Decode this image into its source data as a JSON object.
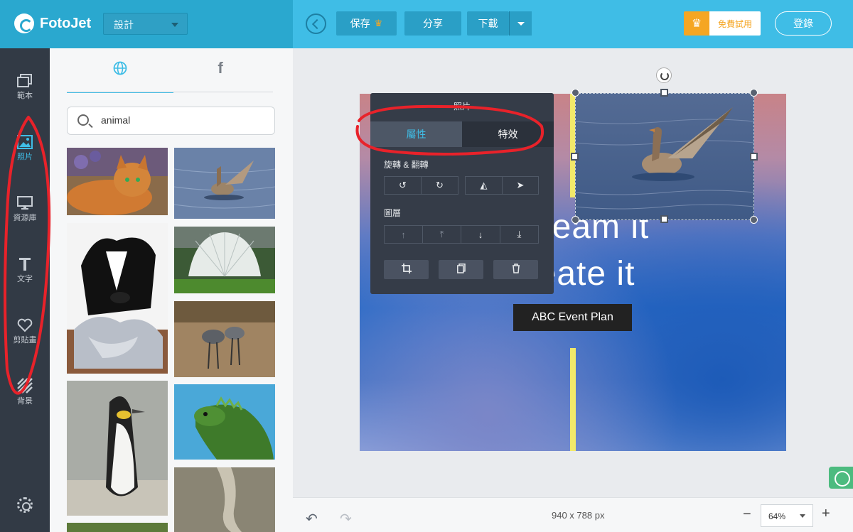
{
  "app": {
    "name": "FotoJet"
  },
  "header": {
    "design_select": "設計",
    "save_label": "保存",
    "share_label": "分享",
    "download_label": "下載",
    "trial_label": "免費試用",
    "login_label": "登錄",
    "colors": {
      "bar": "#3fbde6",
      "bar_left": "#2aa8cf",
      "crown": "#f5a623"
    }
  },
  "sidebar": {
    "items": [
      {
        "label": "範本",
        "icon": "templates-icon"
      },
      {
        "label": "照片",
        "icon": "photo-icon",
        "active": true
      },
      {
        "label": "資源庫",
        "icon": "monitor-icon"
      },
      {
        "label": "文字",
        "icon": "text-icon"
      },
      {
        "label": "剪貼畫",
        "icon": "heart-icon"
      },
      {
        "label": "背景",
        "icon": "background-icon"
      }
    ],
    "settings_icon": "gear-icon"
  },
  "photo_panel": {
    "tabs": [
      {
        "name": "web",
        "icon": "globe-icon",
        "active": true
      },
      {
        "name": "facebook",
        "icon": "facebook-icon"
      }
    ],
    "search": {
      "value": "animal"
    },
    "thumbnails": [
      "cat",
      "goose",
      "border-collie",
      "white-peacock",
      "cranes",
      "penguin",
      "iguana",
      "lizard-tail"
    ]
  },
  "canvas": {
    "text_line_1": "Dream it",
    "text_line_2": "Create it",
    "event_label": "ABC Event Plan",
    "accent_color": "#f2e96a"
  },
  "properties_popup": {
    "title": "照片",
    "tabs": [
      {
        "label": "屬性",
        "active": true
      },
      {
        "label": "特效"
      }
    ],
    "rotate_flip_label": "旋轉 & 翻轉",
    "layer_label": "圖層"
  },
  "footer": {
    "canvas_size": "940 x 788 px",
    "zoom": "64%"
  }
}
